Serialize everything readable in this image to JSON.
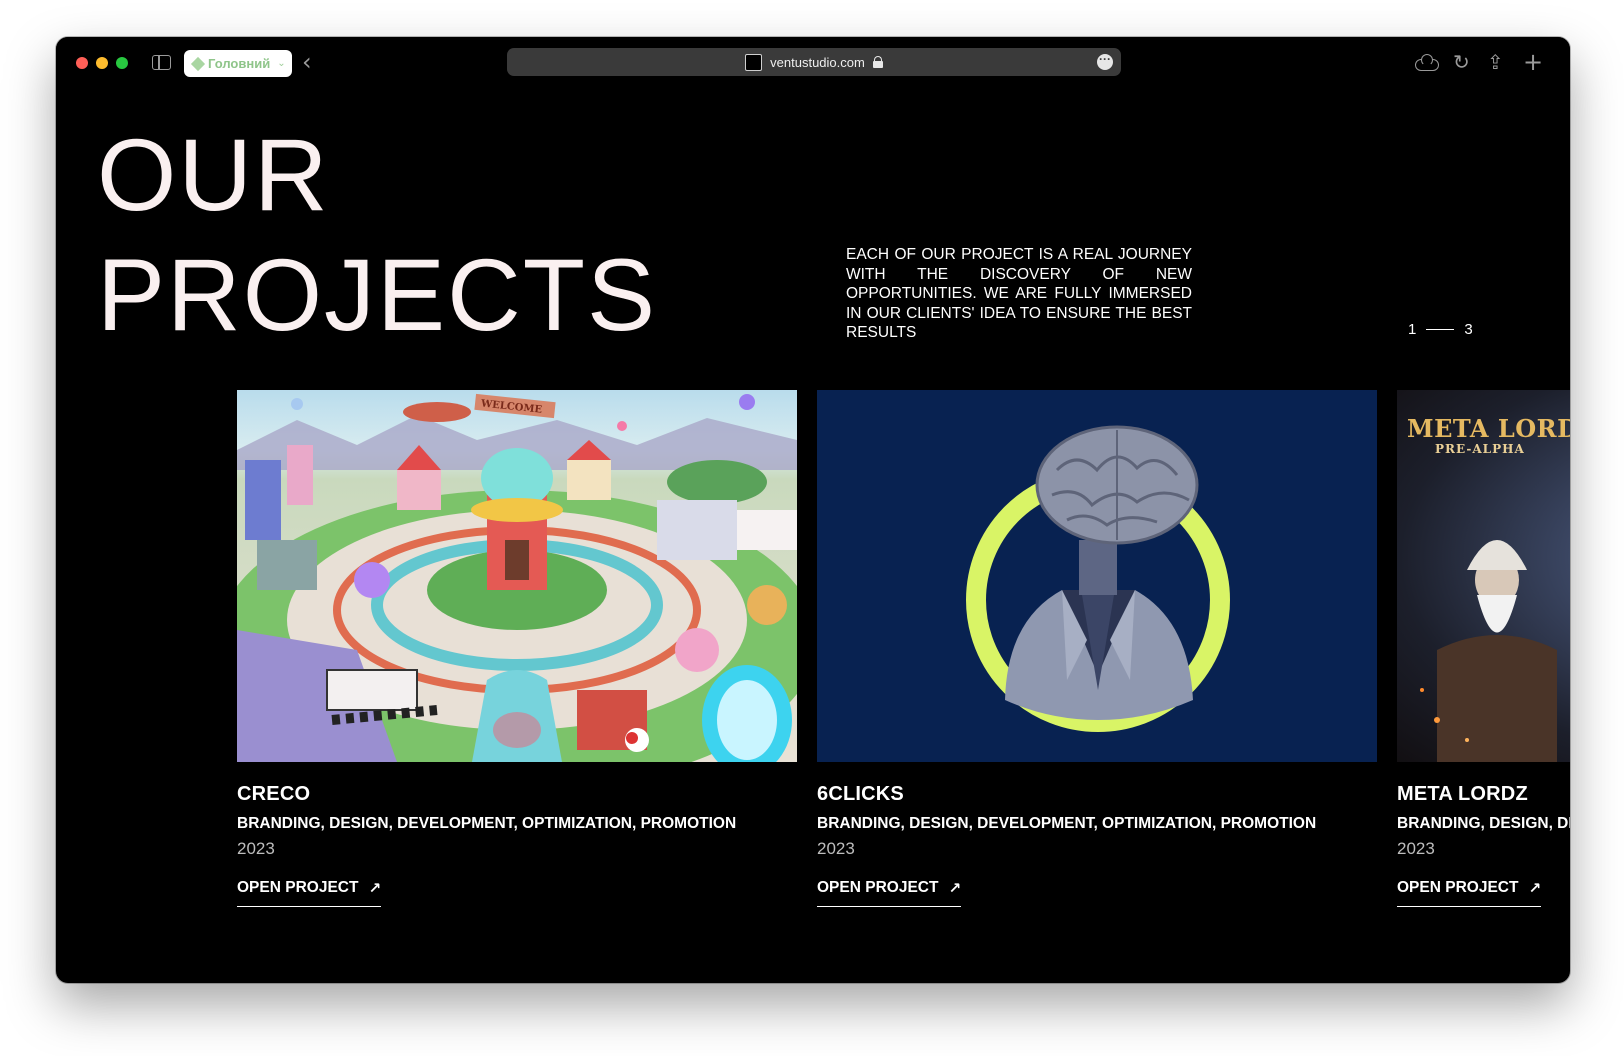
{
  "browser": {
    "profile_label": "Головний",
    "url": "ventustudio.com",
    "icons": [
      "sidebar-icon",
      "back-icon",
      "lock-icon",
      "more-icon",
      "cloud-icon",
      "reload-icon",
      "share-icon",
      "new-tab-icon"
    ]
  },
  "hero": {
    "title_line1": "OUR",
    "title_line2": "PROJECTS",
    "description": "EACH OF OUR PROJECT IS A REAL JOURNEY WITH THE DISCOVERY OF NEW OPPORTUNITIES. WE ARE FULLY IMMERSED IN OUR CLIENTS' IDEA TO ENSURE THE BEST RESULTS"
  },
  "pager": {
    "current": "1",
    "total": "3"
  },
  "projects": [
    {
      "title": "CRECO",
      "tags": "BRANDING, DESIGN, DEVELOPMENT, OPTIMIZATION, PROMOTION",
      "year": "2023",
      "link_label": "OPEN PROJECT",
      "banner_text": "WELCOME"
    },
    {
      "title": "6CLICKS",
      "tags": "BRANDING, DESIGN, DEVELOPMENT, OPTIMIZATION, PROMOTION",
      "year": "2023",
      "link_label": "OPEN PROJECT"
    },
    {
      "title": "META LORDZ",
      "tags": "BRANDING, DESIGN, DEVELOPMENT, OPTIMIZATION, PROMOTION",
      "year": "2023",
      "link_label": "OPEN PROJECT",
      "logo_text": "META LORDZ",
      "logo_subtext": "PRE-ALPHA"
    }
  ],
  "colors": {
    "page_background": "#000000",
    "title_color": "#faf0f0",
    "brain_background": "#082251",
    "ring_color": "#d9f466",
    "address_bar": "#3a3a3a"
  }
}
